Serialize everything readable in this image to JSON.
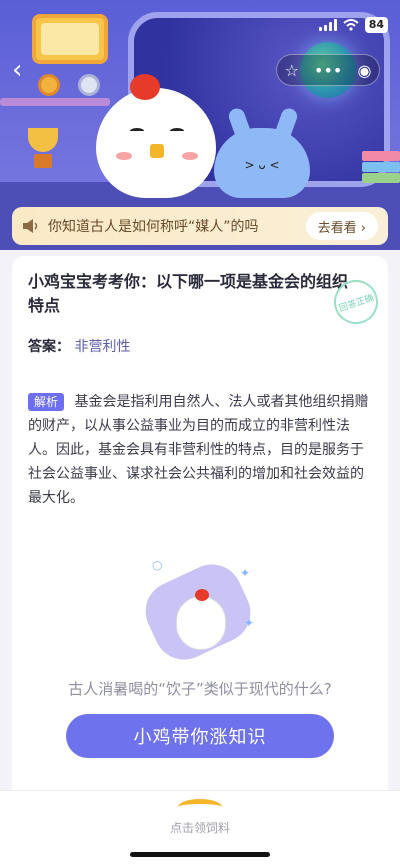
{
  "status_bar": {
    "battery": "84"
  },
  "header": {
    "back_icon": "chevron-left-icon",
    "capsule": {
      "star": "☆",
      "more": "•••",
      "record": "◉"
    }
  },
  "promo": {
    "text": "你知道古人是如何称呼“媒人”的吗",
    "button": "去看看 ›"
  },
  "question": {
    "title": "小鸡宝宝考考你：以下哪一项是基金会的组织特点",
    "stamp": "回答正确",
    "answer_label": "答案：",
    "answer_value": "非营利性",
    "explain_tag": "解析",
    "explain_text": "基金会是指利用自然人、法人或者其他组织捐赠的财产，以从事公益事业为目的而成立的非营利性法人。因此，基金会具有非营利性的特点，目的是服务于社会公益事业、谋求社会公共福利的增加和社会效益的最大化。"
  },
  "next": {
    "teaser": "古人消暑喝的“饮子”类似于现代的什么?",
    "cta": "小鸡带你涨知识"
  },
  "bottom_bar": {
    "label": "点击领饲料"
  },
  "colors": {
    "accent": "#6e72ec",
    "header": "#5a5fd6",
    "promo_bg": "#fbe9c5"
  }
}
